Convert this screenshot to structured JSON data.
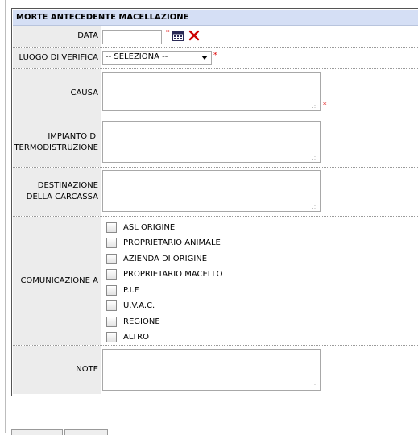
{
  "form": {
    "title": "MORTE ANTECEDENTE MACELLAZIONE",
    "required_mark": "*",
    "data": {
      "label": "DATA",
      "value": ""
    },
    "luogo": {
      "label": "LUOGO DI VERIFICA",
      "selected": "-- SELEZIONA --"
    },
    "causa": {
      "label": "CAUSA"
    },
    "impianto": {
      "label_line1": "IMPIANTO DI",
      "label_line2": "TERMODISTRUZIONE"
    },
    "destinazione": {
      "label_line1": "DESTINAZIONE",
      "label_line2": "DELLA CARCASSA"
    },
    "comunicazione": {
      "label": "COMUNICAZIONE A",
      "options": [
        "ASL ORIGINE",
        "PROPRIETARIO ANIMALE",
        "AZIENDA DI ORIGINE",
        "PROPRIETARIO MACELLO",
        "P.I.F.",
        "U.V.A.C.",
        "REGIONE",
        "ALTRO"
      ]
    },
    "note": {
      "label": "NOTE"
    }
  },
  "icons": {
    "calendar": "calendar-icon",
    "clear": "clear-date-icon"
  },
  "colors": {
    "header_bg": "#d5dff5",
    "label_bg": "#ececec",
    "required": "#dd0000",
    "clear_icon": "#cc0000"
  }
}
